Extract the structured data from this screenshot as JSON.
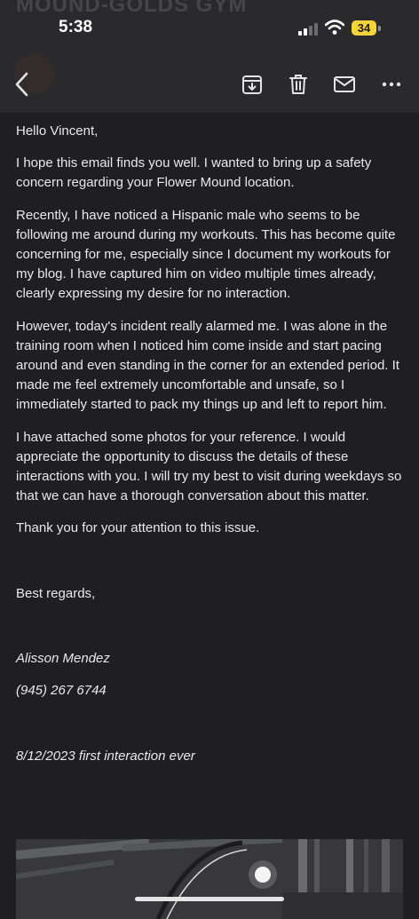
{
  "status_bar": {
    "time": "5:38",
    "battery": "34"
  },
  "header": {
    "ghost_title": "MOUND-GOLDS GYM"
  },
  "email": {
    "greeting": "Hello Vincent,",
    "paragraphs": [
      "I hope this email finds you well. I wanted to bring up a safety concern regarding your Flower Mound location.",
      "Recently, I have noticed a Hispanic male who seems to be following me around during my workouts. This has become quite concerning for me, especially since I document my workouts for my blog. I have captured him on video multiple times already, clearly expressing my desire for no interaction.",
      "However, today's incident really alarmed me. I was alone in the training room when I noticed him come inside and start pacing around and even standing in the corner for an extended period. It made me feel extremely uncomfortable and unsafe, so I immediately started to pack my things up and left to report him.",
      "I have attached some photos for your reference. I would appreciate the opportunity to discuss the details of these interactions with you. I will try my best to visit during weekdays so that we can have a thorough conversation about this matter."
    ],
    "thanks": "Thank you for your attention to this issue.",
    "closing": "Best regards,",
    "signature_name": "Alisson Mendez",
    "phone": "(945) 267 6744",
    "photo_caption": "8/12/2023 first interaction ever"
  },
  "icons": {
    "back": "chevron-left-icon",
    "archive": "archive-icon",
    "trash": "trash-icon",
    "mail": "mail-icon",
    "more": "more-icon"
  },
  "colors": {
    "background": "#1f1f21",
    "header": "#2a2a2c",
    "text": "#e9e9eb",
    "battery": "#f5d33b"
  }
}
